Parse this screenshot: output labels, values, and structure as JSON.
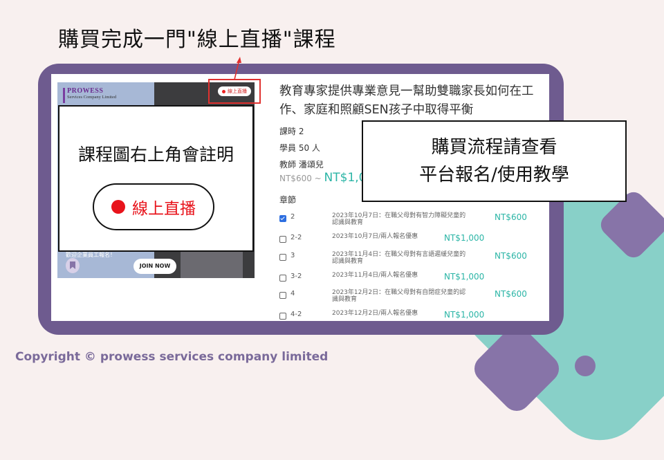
{
  "heading": "購買完成一門\"線上直播\"課程",
  "course_card": {
    "brand_name": "PROWESS",
    "brand_sub": "Services Company Limited",
    "live_badge": "線上直播",
    "image_caption": "歡迎企業員工報名！",
    "join_button": "JOIN NOW"
  },
  "callout_left": {
    "title": "課程圖右上角會註明",
    "live_label": "線上直播"
  },
  "course": {
    "title": "教育專家提供專業意見一幫助雙職家長如何在工作、家庭和照顧SEN孩子中取得平衡",
    "hours": "課時 2",
    "students": "學員 50 人",
    "teacher": "教師 潘頌兒",
    "price_low": "NT$600 ~",
    "price_high": "NT$1,0",
    "chapters_label": "章節"
  },
  "lessons": [
    {
      "num": "2",
      "desc": "2023年10月7日：在職父母對有智力障礙兒童的認識與教育",
      "price": "NT$600",
      "checked": true
    },
    {
      "num": "2-2",
      "desc": "2023年10月7日/兩人報名優惠",
      "price": "NT$1,000",
      "checked": false
    },
    {
      "num": "3",
      "desc": "2023年11月4日：在職父母對有言語遲緩兒童的認識與教育",
      "price": "NT$600",
      "checked": false
    },
    {
      "num": "3-2",
      "desc": "2023年11月4日/兩人報名優惠",
      "price": "NT$1,000",
      "checked": false
    },
    {
      "num": "4",
      "desc": "2023年12月2日：在職父母對有自閉症兒童的認識與教育",
      "price": "NT$600",
      "checked": false
    },
    {
      "num": "4-2",
      "desc": "2023年12月2日/兩人報名優惠",
      "price": "NT$1,000",
      "checked": false
    }
  ],
  "callout_right": {
    "line1": "購買流程請查看",
    "line2": "平台報名/使用教學"
  },
  "copyright": "Copyright © prowess services company limited",
  "colors": {
    "frame": "#6e5b8f",
    "accent_teal": "#2bb5a6",
    "live_red": "#e8131b",
    "background": "#f8f0ef"
  }
}
